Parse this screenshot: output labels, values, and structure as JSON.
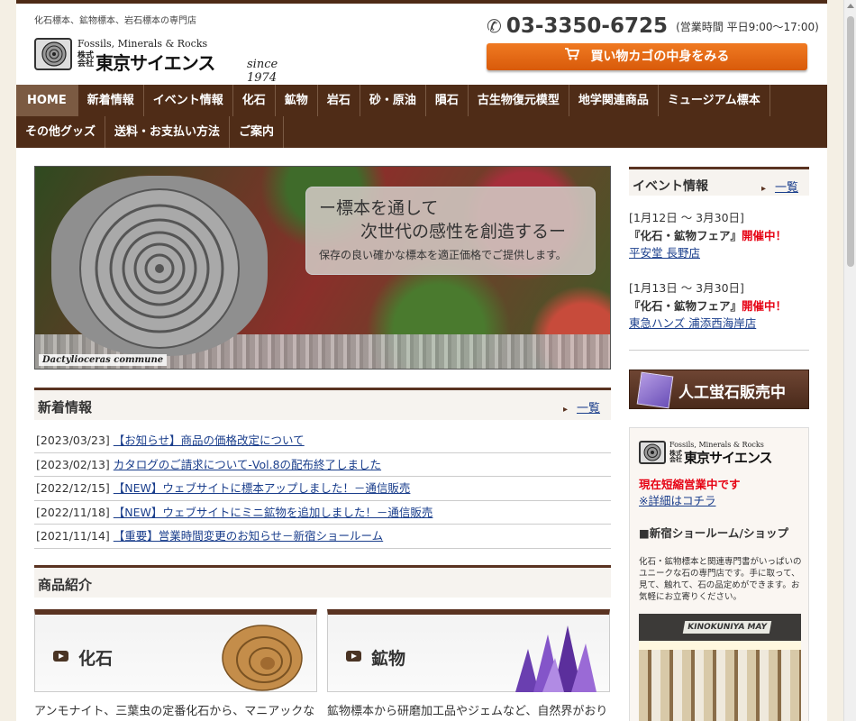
{
  "header": {
    "tagline": "化石標本、鉱物標本、岩石標本の専門店",
    "logo_en": "Fossils, Minerals & Rocks",
    "logo_kk": "株式会社",
    "logo_jp": "東京サイエンス",
    "logo_since": "since 1974",
    "phone_icon": "✆",
    "phone": "03-3350-6725",
    "hours": "(営業時間 平日9:00〜17:00)",
    "cart_label": "買い物カゴの中身をみる",
    "accent_color": "#e8691a"
  },
  "nav": {
    "row1": [
      "HOME",
      "新着情報",
      "イベント情報",
      "化石",
      "鉱物",
      "岩石",
      "砂・原油",
      "隕石",
      "古生物復元模型",
      "地学関連商品",
      "ミュージアム標本"
    ],
    "row2": [
      "その他グッズ",
      "送料・お支払い方法",
      "ご案内"
    ]
  },
  "hero": {
    "copy_line1": "ー標本を通して",
    "copy_line2": "次世代の感性を創造するー",
    "copy_line3": "保存の良い確かな標本を適正価格でご提供します。",
    "species": "Dactylioceras commune"
  },
  "news": {
    "title": "新着情報",
    "more": "一覧",
    "items": [
      {
        "date": "[2023/03/23]",
        "text": "【お知らせ】商品の価格改定について"
      },
      {
        "date": "[2023/02/13]",
        "text": "カタログのご請求について-Vol.8の配布終了しました"
      },
      {
        "date": "[2022/12/15]",
        "text": "【NEW】ウェブサイトに標本アップしました！－通信販売"
      },
      {
        "date": "[2022/11/18]",
        "text": "【NEW】ウェブサイトにミニ鉱物を追加しました！－通信販売"
      },
      {
        "date": "[2021/11/14]",
        "text": "【重要】営業時間変更のお知らせ－新宿ショールーム"
      }
    ]
  },
  "products": {
    "title": "商品紹介",
    "cards": [
      {
        "name": "化石",
        "desc": "アンモナイト、三葉虫の定番化石から、マニアックなものまで数多く揃えております。"
      },
      {
        "name": "鉱物",
        "desc": "鉱物標本から研磨加工品やジェムなど、自然界がおりなす様々な美しい鉱物の結晶群をお楽しみください。"
      }
    ]
  },
  "events": {
    "title": "イベント情報",
    "more": "一覧",
    "items": [
      {
        "date": "[1月12日 〜 3月30日]",
        "title": "『化石・鉱物フェア』",
        "status": "開催中！",
        "location": "平安堂 長野店"
      },
      {
        "date": "[1月13日 〜 3月30日]",
        "title": "『化石・鉱物フェア』",
        "status": "開催中！",
        "location": "東急ハンズ 浦添西海岸店"
      }
    ]
  },
  "sidebar": {
    "banner": "人工蛍石販売中",
    "shop_short_hours": "現在短縮営業中です",
    "shop_details": "※詳細はコチラ",
    "shop_title": "■新宿ショールーム/ショップ",
    "shop_desc": "化石・鉱物標本と関連専門書がいっぱいのユニークな石の専門店です。手に取って、見て、触れて、石の品定めができます。お気軽にお立寄りください。",
    "photo_sign": "KINOKUNIYA MAY"
  }
}
